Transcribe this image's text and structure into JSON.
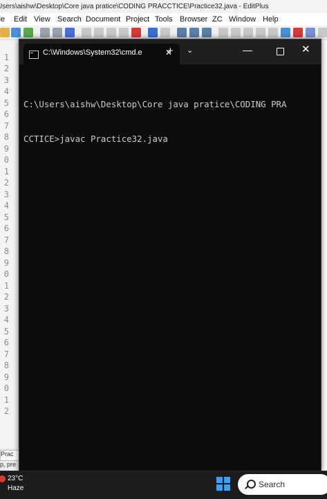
{
  "editor": {
    "title": "Users\\aishw\\Desktop\\Core java pratice\\CODING PRACCTICE\\Practice32.java - EditPlus",
    "menu": [
      "lle",
      "Edit",
      "View",
      "Search",
      "Document",
      "Project",
      "Tools",
      "Browser",
      "ZC",
      "Window",
      "Help"
    ],
    "line_numbers": [
      "1",
      "2",
      "3",
      "4",
      "5",
      "6",
      "7",
      "8",
      "9",
      "0",
      "1",
      "2",
      "3",
      "4",
      "5",
      "6",
      "7",
      "8",
      "9",
      "0",
      "1",
      "2",
      "3",
      "4",
      "5",
      "6",
      "7",
      "8",
      "9",
      "0",
      "1",
      "2"
    ],
    "tab_label": "Prac",
    "status_text": "p, pre"
  },
  "cmd": {
    "tab_title": "C:\\Windows\\System32\\cmd.e",
    "newtab_glyph": "+",
    "dropdown_glyph": "⌄",
    "minimize_glyph": "—",
    "close_glyph": "✕",
    "lines": [
      "C:\\Users\\aishw\\Desktop\\Core java pratice\\CODING PRA",
      "CCTICE>javac Practice32.java"
    ]
  },
  "taskbar": {
    "temperature": "23°C",
    "condition": "Haze",
    "search_label": "Search",
    "weather_color": "#d93a2b",
    "start_color": "#3aa0ff"
  }
}
